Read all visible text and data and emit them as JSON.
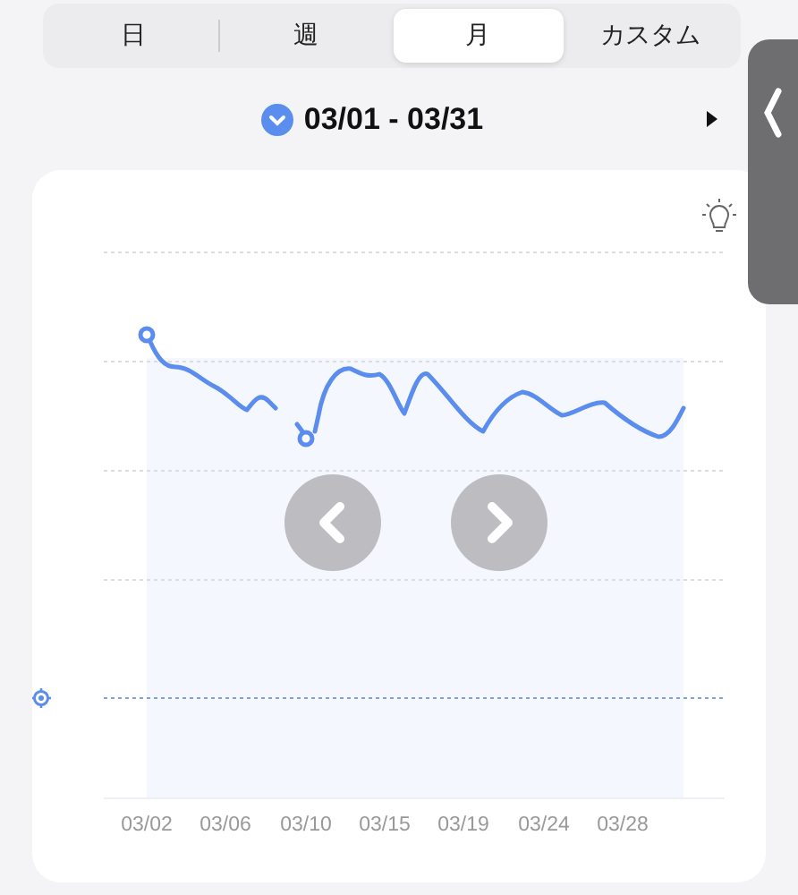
{
  "tabs": [
    {
      "label": "日",
      "selected": false
    },
    {
      "label": "週",
      "selected": false
    },
    {
      "label": "月",
      "selected": true
    },
    {
      "label": "カスタム",
      "selected": false
    }
  ],
  "date_range": {
    "label": "03/01 - 03/31"
  },
  "chart": {
    "x_labels": [
      "03/02",
      "03/06",
      "03/10",
      "03/15",
      "03/19",
      "03/24",
      "03/28"
    ]
  }
}
